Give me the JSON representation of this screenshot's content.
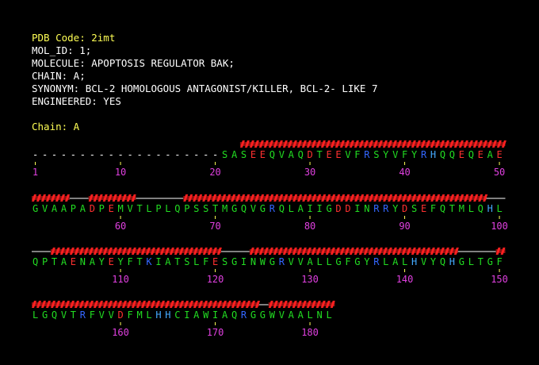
{
  "header": {
    "pdb_code_line": "PDB Code: 2imt",
    "mol_id_line": "MOL_ID: 1;",
    "molecule_line": "MOLECULE: APOPTOSIS REGULATOR BAK;",
    "chain_line": "CHAIN: A;",
    "synonym_line": "SYNONYM: BCL-2 HOMOLOGOUS ANTAGONIST/KILLER, BCL-2- LIKE 7",
    "engineered_line": "ENGINEERED: YES"
  },
  "chain_label": "Chain: A",
  "colors": {
    "background": "#000000",
    "title_yellow": "#ffff55",
    "residue_hydrophobic": "#22dd22",
    "residue_acidic": "#ff3030",
    "residue_basic": "#3366ff",
    "residue_histidine": "#44aaff",
    "residue_other": "#22dd22",
    "gap": "#ffffff",
    "helix": "#ff2020",
    "coil": "#ffffff",
    "number": "#e040e0"
  },
  "rows": [
    {
      "sequence": "--------------------SASEEQVAQDTEEVFRSYVFYRHQQEQEAE",
      "start": 1,
      "numbers": [
        "1",
        "10",
        "20",
        "30",
        "40",
        "50"
      ],
      "secondary": "CCCCCCCCCCCCCCCCCCCCCCHHHHHHHHHHHHHHHHHHHHHHHHHHHH",
      "coil_from": 20
    },
    {
      "sequence": "GVAAPADPEMVTLPLQPSSTMGQVGRQLAIIGDDINRRYDSEFQTMLQHL",
      "start": 51,
      "numbers": [
        "60",
        "70",
        "80",
        "90",
        "100"
      ],
      "secondary": "HHHHCCHHHHHCCCCCHHHHHHHHHHHHHHHHHHHHHHHHHHHHHHHHCC",
      "coil_from": 0
    },
    {
      "sequence": "QPTAENAYEYFTKIATSLFESGINWGRVVALLGFGYRLALHVYQHGLTGF",
      "start": 101,
      "numbers": [
        "110",
        "120",
        "130",
        "140",
        "150"
      ],
      "secondary": "CCHHHHHHHHHHHHHHHHHHCCCHHHHHHHHHHHHHHHHHHHHHHCCCCH",
      "coil_from": 0
    },
    {
      "sequence": "LGQVTRFVVDFMLHHCIAWIAQRGGWVAALNL",
      "start": 151,
      "numbers": [
        "160",
        "170",
        "180"
      ],
      "secondary": "HHHHHHHHHHHHHHHHHHHHHHHHCHHHHHHH",
      "coil_from": 0
    }
  ]
}
